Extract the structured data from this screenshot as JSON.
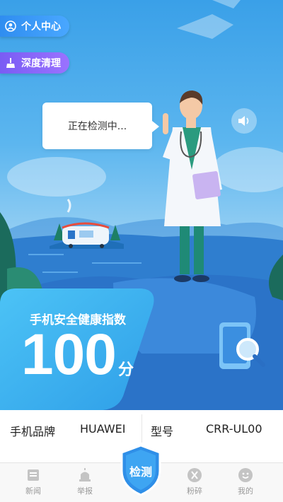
{
  "top_buttons": {
    "personal_center": "个人中心",
    "deep_clean": "深度清理"
  },
  "bubble": {
    "text": "正在检测中..."
  },
  "score": {
    "label": "手机安全健康指数",
    "value": "100",
    "unit": "分"
  },
  "device_info": {
    "brand_label": "手机品牌",
    "brand_value": "HUAWEI",
    "model_label": "型号",
    "model_value": "CRR-UL00"
  },
  "tabbar": {
    "items": [
      {
        "label": "新闻",
        "icon": "news-icon"
      },
      {
        "label": "举报",
        "icon": "report-icon"
      },
      {
        "label": "检测",
        "icon": "shield-icon"
      },
      {
        "label": "粉碎",
        "icon": "shred-icon"
      },
      {
        "label": "我的",
        "icon": "profile-icon"
      }
    ]
  },
  "colors": {
    "sky_top": "#3aa0e8",
    "accent_blue": "#2f8df0",
    "accent_purple": "#7a5cf4",
    "tab_inactive": "#9a9a9a"
  }
}
